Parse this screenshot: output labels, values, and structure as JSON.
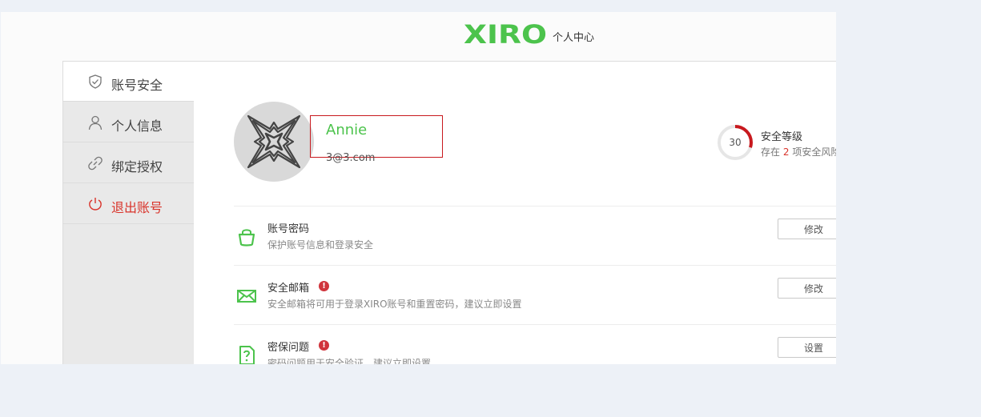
{
  "header": {
    "logo_text": "XIRO",
    "title": "个人中心",
    "brand_color": "#4cc34c"
  },
  "sidebar": {
    "items": [
      {
        "label": "账号安全",
        "icon": "shield-icon",
        "active": true
      },
      {
        "label": "个人信息",
        "icon": "user-icon"
      },
      {
        "label": "绑定授权",
        "icon": "link-icon"
      },
      {
        "label": "退出账号",
        "icon": "power-icon",
        "color": "#d9342b"
      }
    ]
  },
  "profile": {
    "username": "Annie",
    "email": "3@3.com",
    "avatar_icon": "xiro-drone-logo-icon"
  },
  "security": {
    "score": "30",
    "score_fraction": 0.3,
    "title": "安全等级",
    "desc_prefix": "存在",
    "risk_count": "2",
    "desc_suffix": "项安全风险"
  },
  "rows": [
    {
      "icon": "lock-icon",
      "title": "账号密码",
      "desc": "保护账号信息和登录安全",
      "warning": false,
      "button": "修改"
    },
    {
      "icon": "mail-icon",
      "title": "安全邮箱",
      "desc": "安全邮箱将可用于登录XIRO账号和重置密码，建议立即设置",
      "warning": true,
      "button": "修改"
    },
    {
      "icon": "question-doc-icon",
      "title": "密保问题",
      "desc": "密码问题用于安全验证，建议立即设置",
      "warning": true,
      "button": "设置"
    }
  ]
}
